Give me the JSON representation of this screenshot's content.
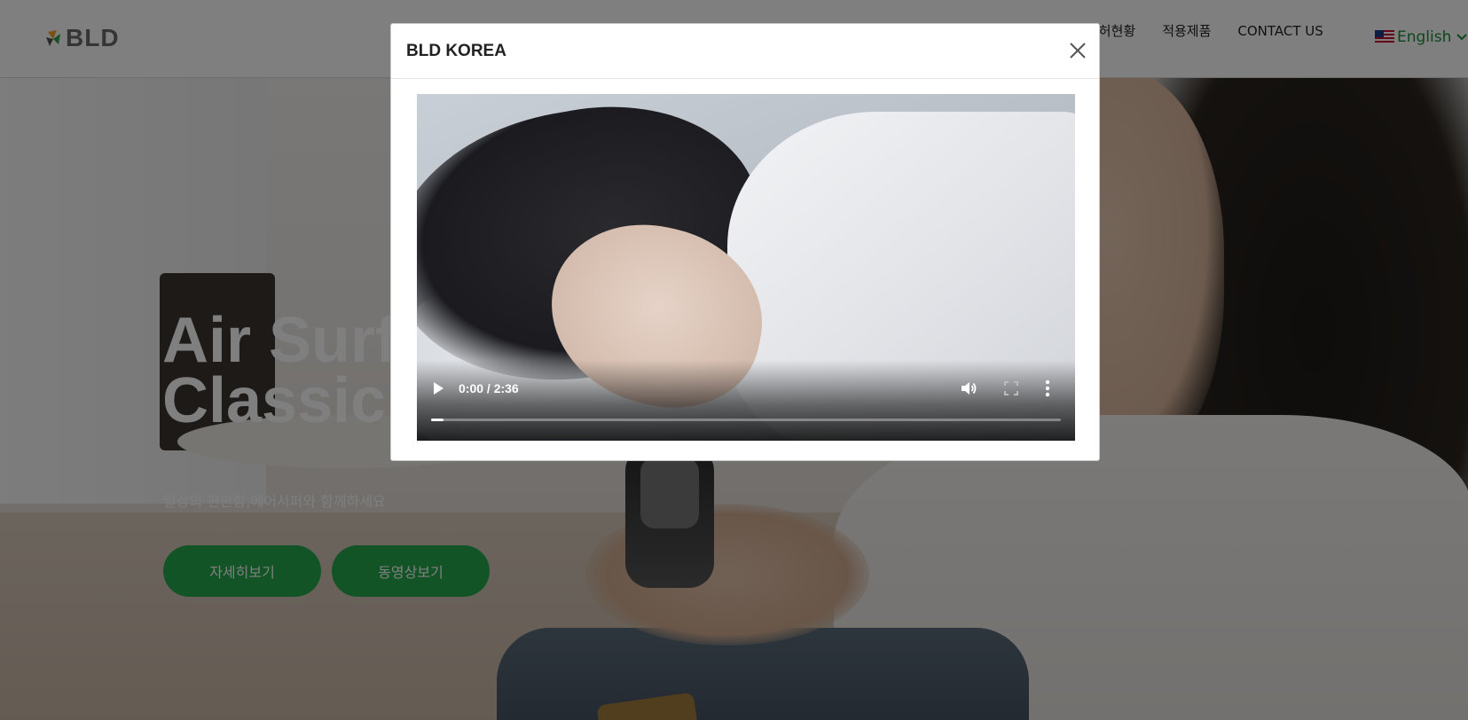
{
  "header": {
    "logo_text": "BLD",
    "nav": [
      {
        "label": "특허현황"
      },
      {
        "label": "적용제품"
      },
      {
        "label": "CONTACT US"
      }
    ],
    "language": {
      "label": "English",
      "flag_icon": "us-flag-icon"
    }
  },
  "hero": {
    "title": "Air Surfer\nClassic",
    "subtitle": "일상의 편안함,에어서퍼와 함께하세요",
    "buttons": [
      {
        "label": "자세히보기"
      },
      {
        "label": "동영상보기"
      }
    ],
    "accent_color": "#27a94f"
  },
  "modal": {
    "title": "BLD KOREA",
    "close_icon": "close-icon",
    "video": {
      "time": "0:00 / 2:36",
      "progress": 0.0,
      "controls": [
        "play-icon",
        "volume-icon",
        "fullscreen-icon",
        "more-options-icon"
      ]
    }
  }
}
